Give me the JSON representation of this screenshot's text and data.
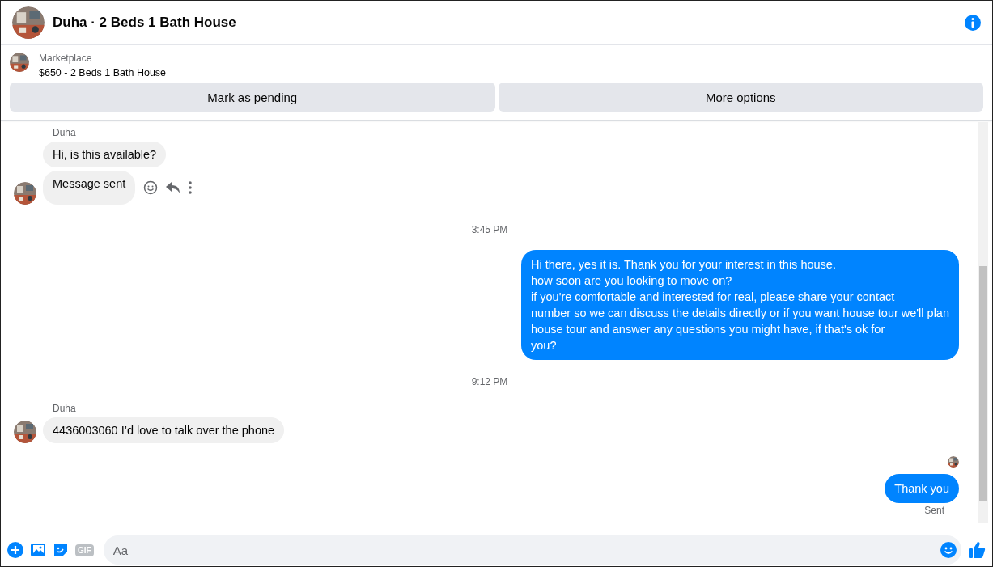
{
  "header": {
    "title": "Duha · 2 Beds 1 Bath House"
  },
  "listing": {
    "source": "Marketplace",
    "title": "$650 - 2 Beds 1 Bath House"
  },
  "actions": [
    "Mark as pending",
    "More options"
  ],
  "thread": [
    {
      "kind": "sender",
      "text": "Duha"
    },
    {
      "kind": "incoming",
      "text": "Hi, is this available?",
      "avatar": false,
      "tools": false
    },
    {
      "kind": "incoming",
      "text": "Message sent",
      "avatar": true,
      "tools": true
    },
    {
      "kind": "time",
      "text": "3:45 PM"
    },
    {
      "kind": "outgoing",
      "text": "Hi there, yes it is. Thank you for your interest in this house.\nhow soon are you looking to move on?\nif you're comfortable and interested for real, please share your contact\nnumber so we can discuss the details directly or if you want house tour we'll plan\nhouse tour and answer any questions you might have, if that's ok for\nyou?"
    },
    {
      "kind": "time",
      "text": "9:12 PM"
    },
    {
      "kind": "sender",
      "text": "Duha"
    },
    {
      "kind": "incoming",
      "text": "4436003060 I’d love to talk over the phone",
      "avatar": true,
      "tools": false
    },
    {
      "kind": "seen"
    },
    {
      "kind": "outgoing",
      "text": "Thank you"
    },
    {
      "kind": "status",
      "text": "Sent"
    }
  ],
  "composer": {
    "gif": "GIF",
    "placeholder": "Aa"
  }
}
